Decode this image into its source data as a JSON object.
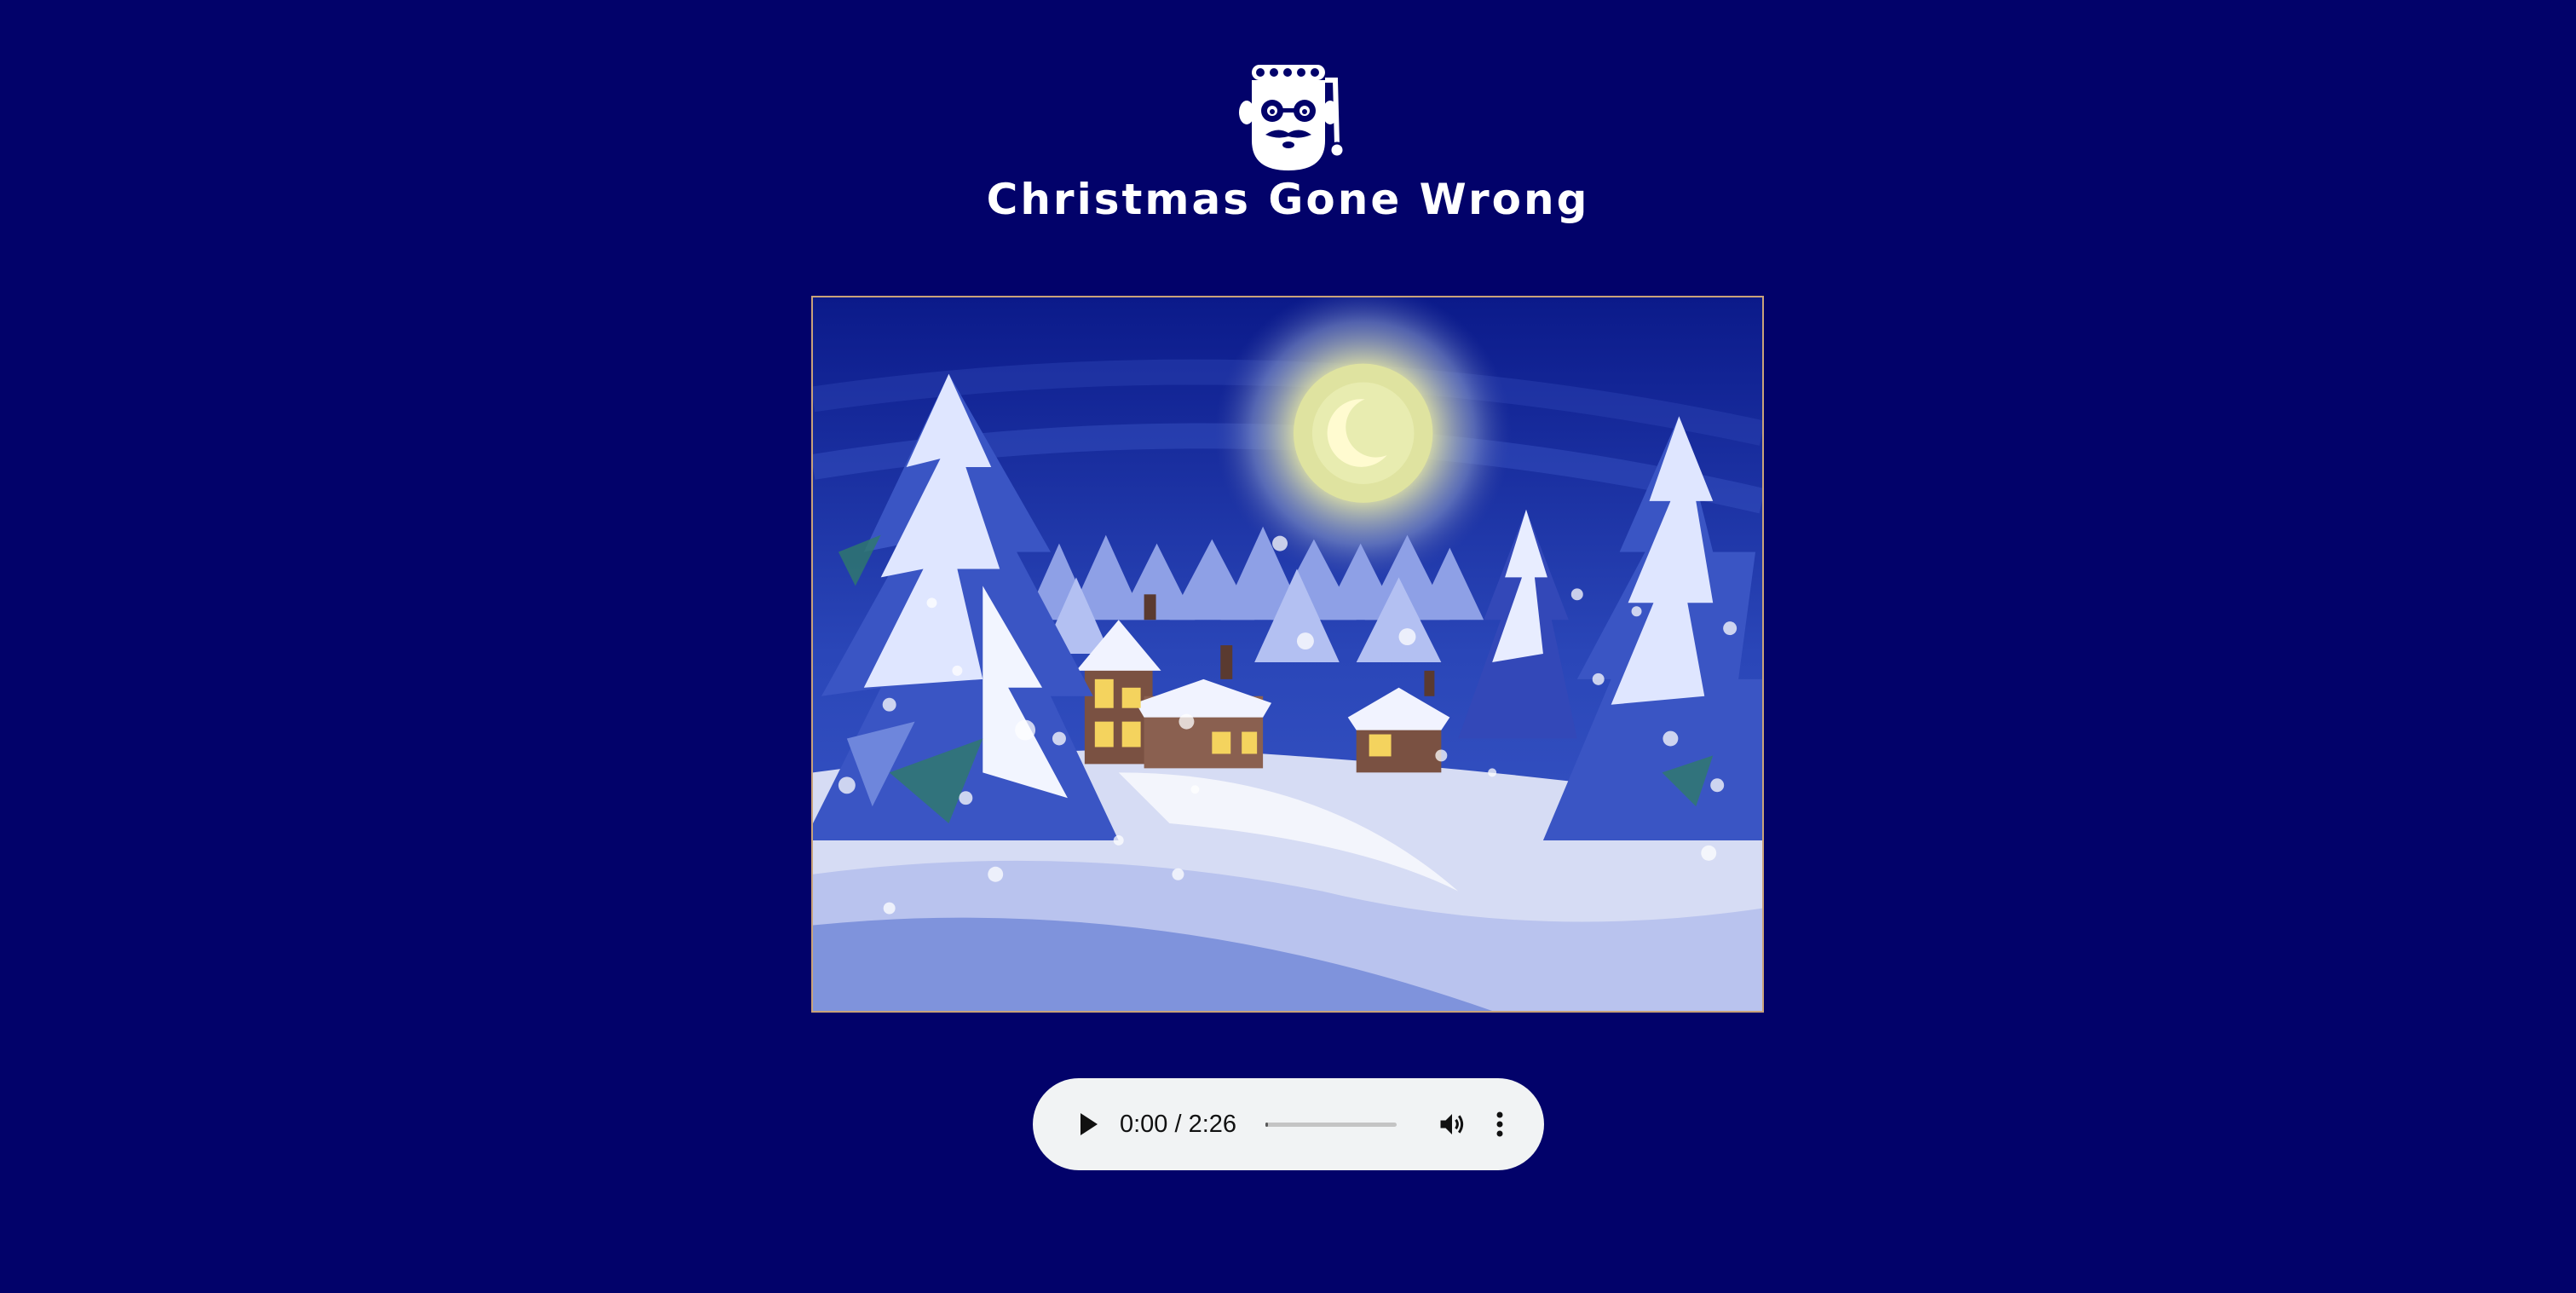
{
  "page": {
    "title": "Christmas Gone Wrong",
    "background_color": "#02026a"
  },
  "logo": {
    "icon": "santa-face-icon",
    "color": "#ffffff"
  },
  "scene": {
    "icon": "snowy-village-night-illustration",
    "border_color": "#c9a27a"
  },
  "audio_player": {
    "current_time": "0:00",
    "duration": "2:26",
    "time_display": "0:00 / 2:26",
    "progress": 0,
    "play_icon": "play-icon",
    "volume_icon": "volume-icon",
    "more_icon": "more-options-icon"
  }
}
